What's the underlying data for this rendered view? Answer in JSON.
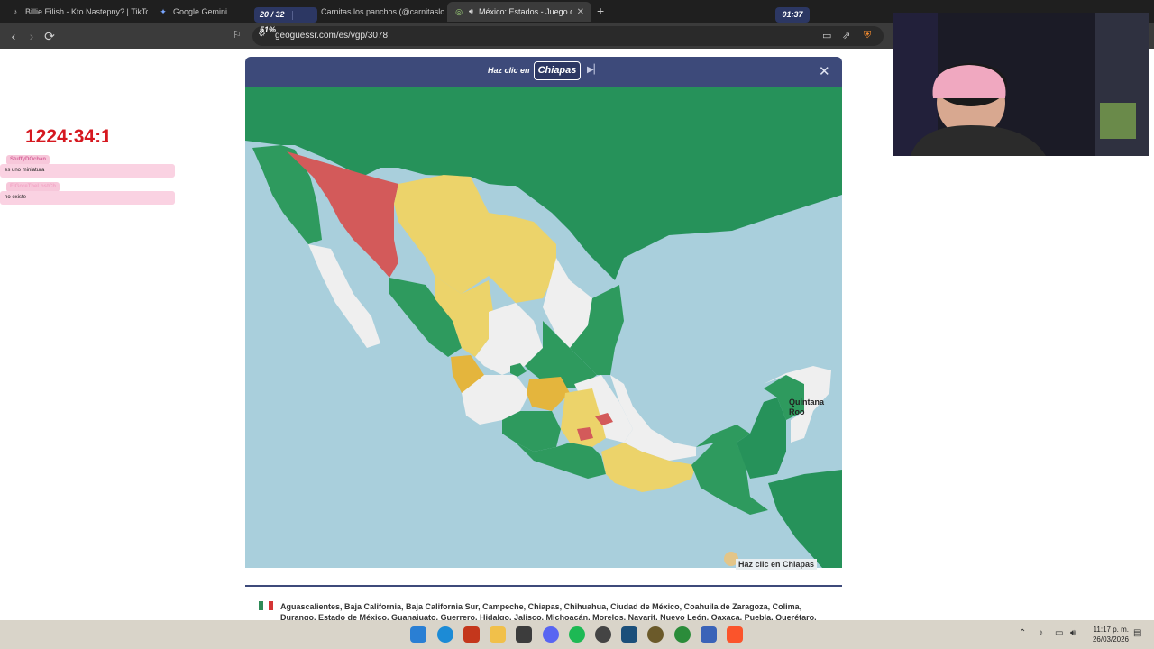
{
  "browser": {
    "tabs": [
      {
        "label": "Billie Eilish - Kto Nastepny? | TikTok",
        "icon": "tiktok-icon"
      },
      {
        "label": "Google Gemini",
        "icon": "gemini-icon"
      },
      {
        "label": "Carnitas los panchos (@carnitaslospa",
        "icon": "tiktok-icon"
      },
      {
        "label": "México: Estados - Juego de M",
        "icon": "geoguessr-icon",
        "active": true
      }
    ],
    "url": "geoguessr.com/es/vgp/3078"
  },
  "overlay": {
    "timer": "1224:34:1",
    "chat": [
      {
        "user": "StuffyDOchan",
        "message": "es uno miniatura"
      },
      {
        "user": "ElGoreTheLostCh",
        "message": "no existe"
      }
    ]
  },
  "game": {
    "progress": "20 / 32",
    "percent": "51%",
    "prompt": "Haz clic en",
    "target": "Chiapas",
    "time": "01:37",
    "map_label": "Quintana\nRoo",
    "hint": "Haz clic en Chiapas",
    "states_list": "Aguascalientes, Baja California, Baja California Sur, Campeche, Chiapas, Chihuahua, Ciudad de México, Coahuila de Zaragoza, Colima, Durango, Estado de México, Guanajuato, Guerrero, Hidalgo, Jalisco, Michoacán, Morelos, Nayarit, Nuevo León, Oaxaca, Puebla, Querétaro, Quintana Roo,"
  },
  "colors": {
    "header": "#3d4a7a",
    "sea": "#a9cfdc",
    "land_outside": "#26925a",
    "correct": "#2e9a5e",
    "second_try": "#ecd36a",
    "third_try": "#e4b53d",
    "wrong": "#d35a5a",
    "unanswered": "#efefef"
  },
  "taskbar": {
    "time": "11:17 p. m.",
    "date": "26/03/2026"
  }
}
